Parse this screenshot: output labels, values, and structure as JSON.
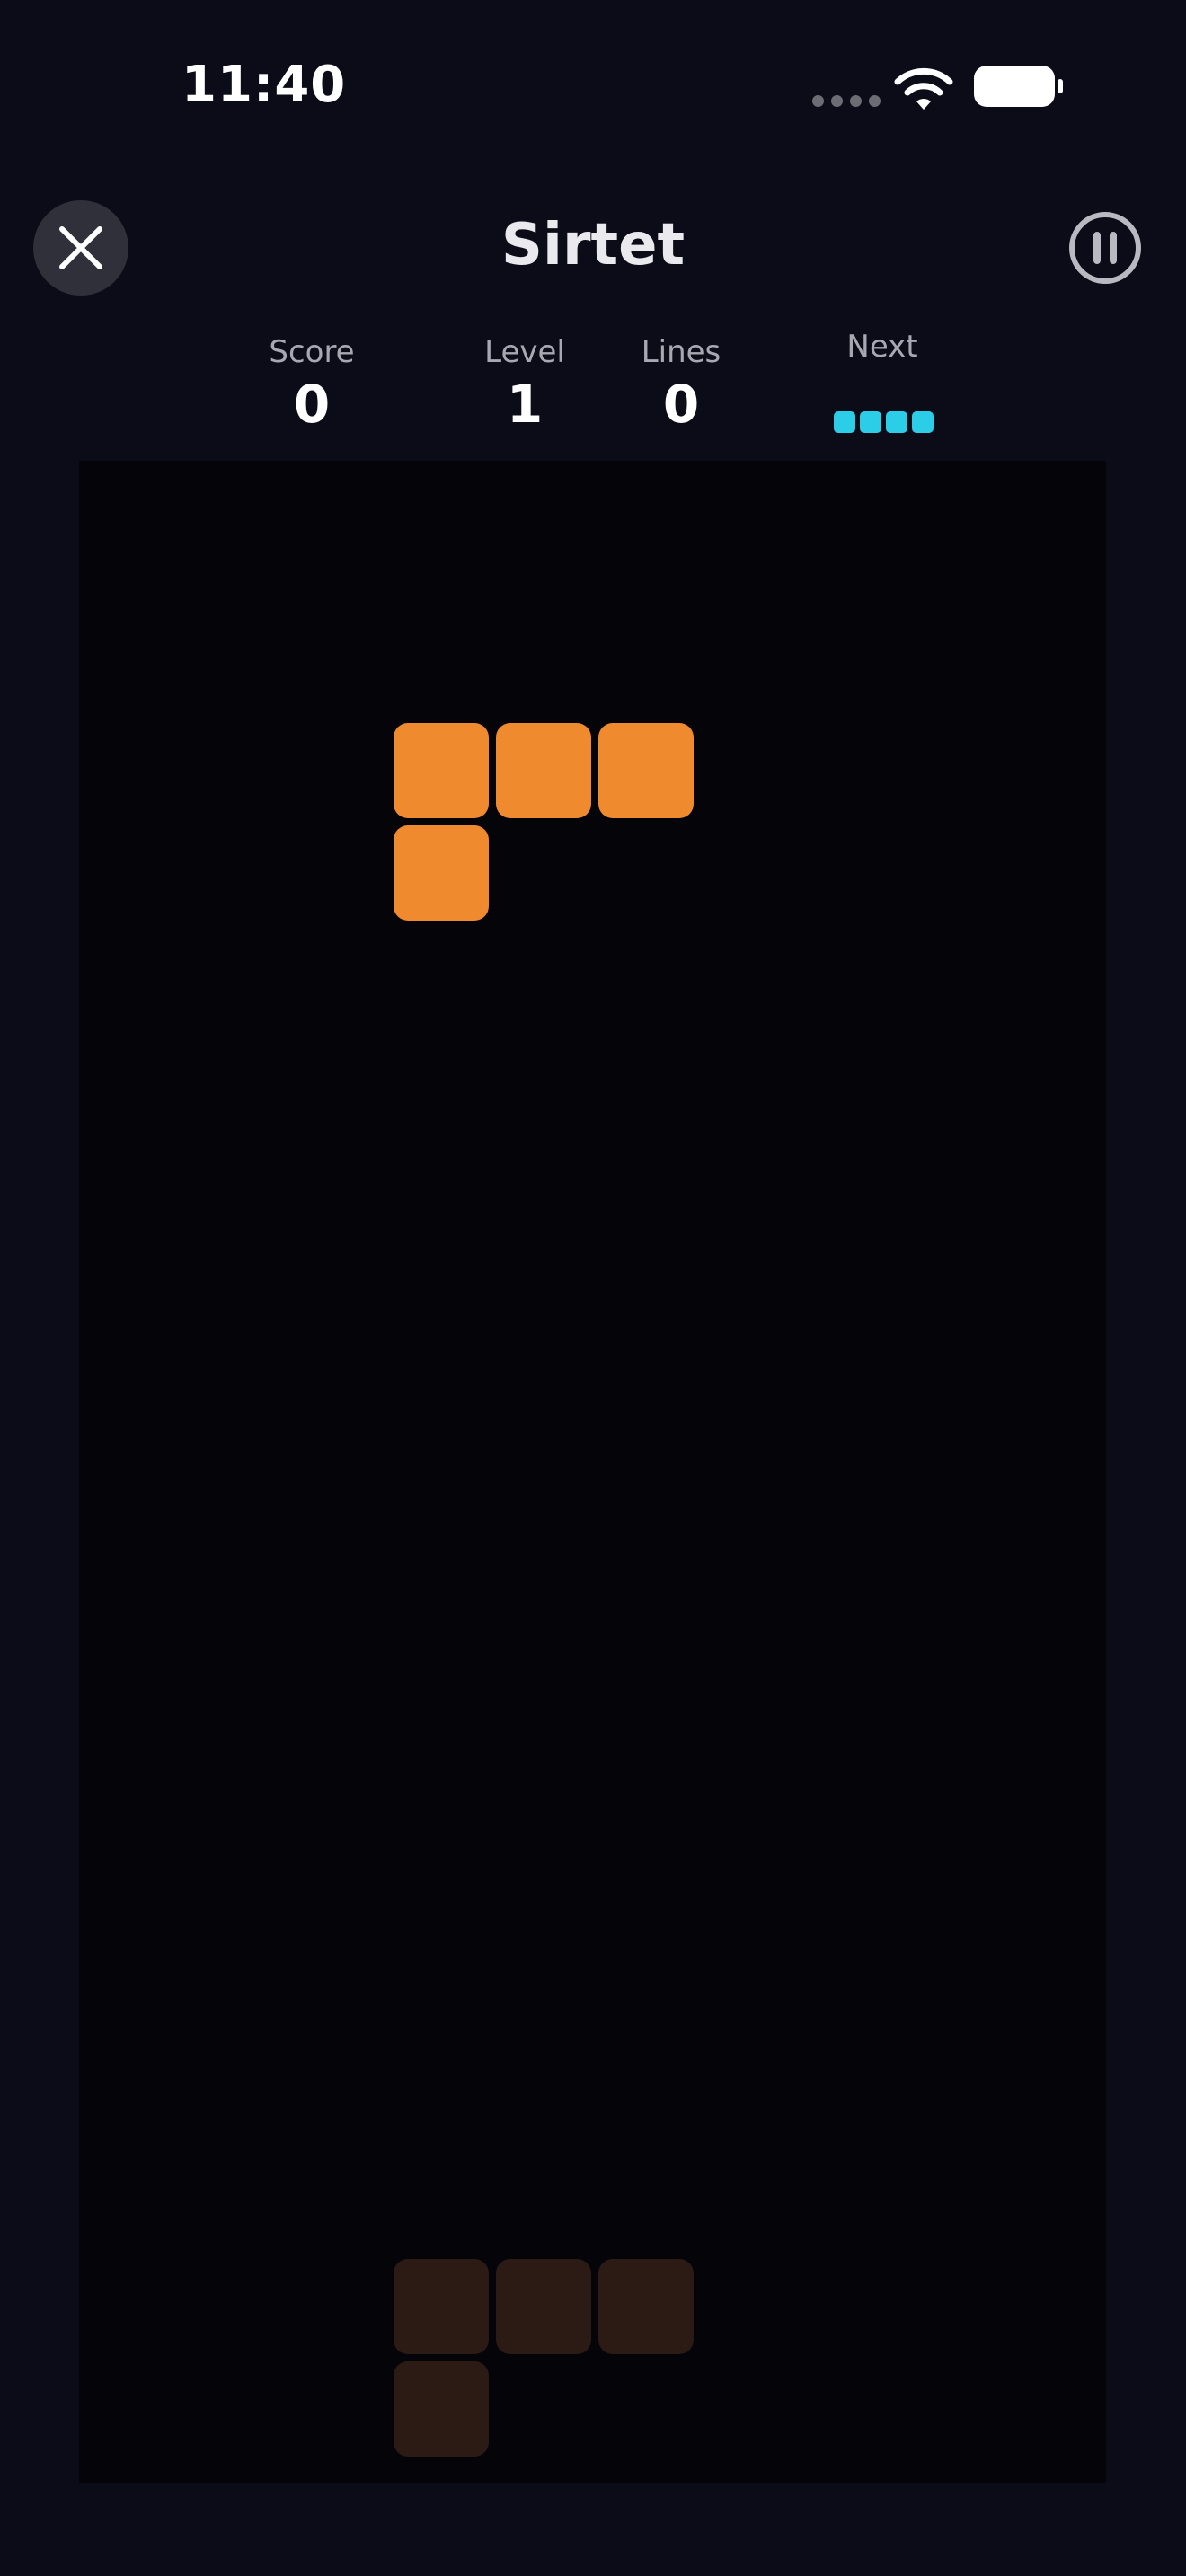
{
  "status_bar": {
    "time": "11:40"
  },
  "header": {
    "title": "Sirtet"
  },
  "stats": {
    "score_label": "Score",
    "score_value": "0",
    "level_label": "Level",
    "level_value": "1",
    "lines_label": "Lines",
    "lines_value": "0",
    "next_label": "Next"
  },
  "next_piece": {
    "type": "I",
    "color": "#2ccde6",
    "cells": 4
  },
  "board": {
    "columns": 10,
    "rows": 20,
    "active_piece": {
      "type": "L",
      "color": "#ef8a2f",
      "cells": [
        [
          3,
          3
        ],
        [
          4,
          3
        ],
        [
          5,
          3
        ],
        [
          3,
          4
        ]
      ]
    },
    "ghost_piece": {
      "color": "#2c1b14",
      "cells": [
        [
          3,
          18
        ],
        [
          4,
          18
        ],
        [
          5,
          18
        ],
        [
          3,
          19
        ]
      ]
    }
  },
  "colors": {
    "background": "#0b0c17",
    "board": "#050509",
    "close_button": "#2f3039",
    "label": "#a7a8b2"
  }
}
